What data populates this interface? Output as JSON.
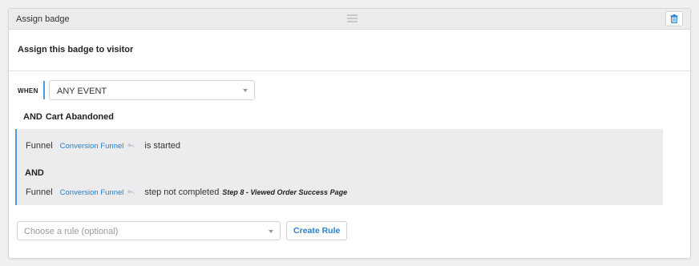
{
  "panel": {
    "title": "Assign badge",
    "subtitle": "Assign this badge to visitor"
  },
  "when": {
    "label": "WHEN",
    "event_value": "ANY EVENT"
  },
  "trigger": {
    "and_label": "AND",
    "name": "Cart Abandoned"
  },
  "conditions": [
    {
      "type": "Funnel",
      "funnel": "Conversion Funnel",
      "action": "is started"
    },
    {
      "type": "Funnel",
      "funnel": "Conversion Funnel",
      "action": "step not completed",
      "step": "Step 8 - Viewed Order Success Page"
    }
  ],
  "conditions_join": "AND",
  "rule": {
    "placeholder": "Choose a rule (optional)",
    "create_label": "Create Rule"
  },
  "icons": {
    "delete": "trash-icon",
    "drag": "drag-handle-icon",
    "undo": "undo-arrow-icon",
    "caret": "caret-down-icon"
  },
  "colors": {
    "accent": "#4a9be0",
    "link": "#2a7fc9",
    "delete": "#2a7fc9"
  }
}
